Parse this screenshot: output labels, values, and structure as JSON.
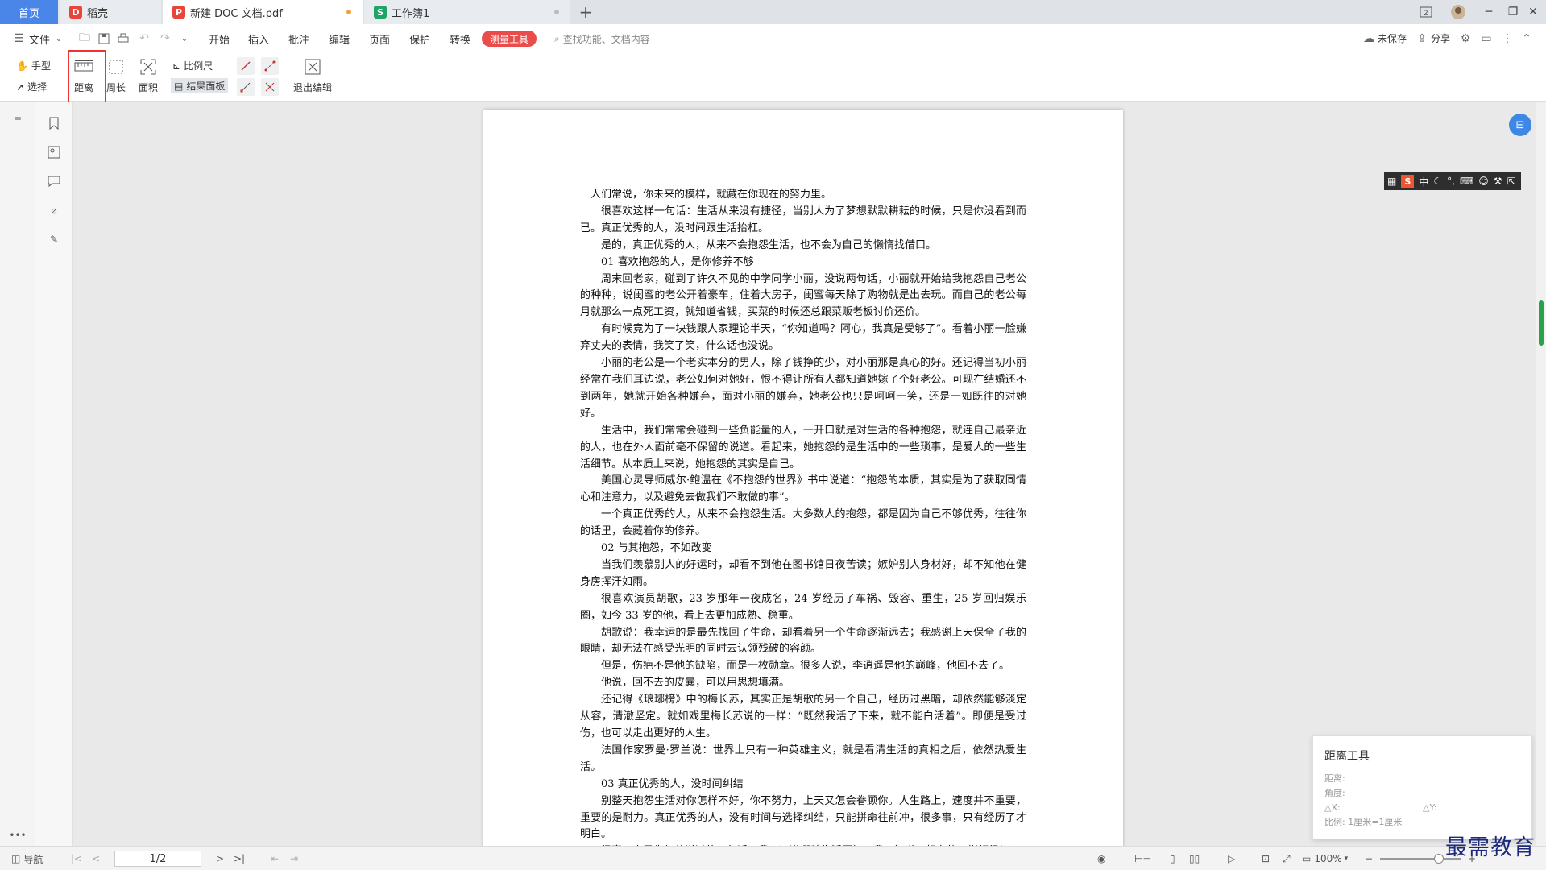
{
  "tabs": {
    "home": "首页",
    "tab1": "稻壳",
    "tab2": "新建 DOC 文档.pdf",
    "tab3": "工作簿1",
    "add": "+"
  },
  "menu": {
    "file": "文件",
    "items": [
      "开始",
      "插入",
      "批注",
      "编辑",
      "页面",
      "保护",
      "转换"
    ],
    "active": "测量工具",
    "search_placeholder": "查找功能、文档内容",
    "unsaved": "未保存",
    "share": "分享"
  },
  "ribbon": {
    "hand": "手型",
    "select": "选择",
    "distance": "距离",
    "perimeter": "周长",
    "area": "面积",
    "scale": "比例尺",
    "result_panel": "结果面板",
    "exit_edit": "退出编辑"
  },
  "document": {
    "paragraphs": [
      "人们常说，你未来的模样，就藏在你现在的努力里。",
      "很喜欢这样一句话：生活从来没有捷径，当别人为了梦想默默耕耘的时候，只是你没看到而已。真正优秀的人，没时间跟生活抬杠。",
      "是的，真正优秀的人，从来不会抱怨生活，也不会为自己的懒惰找借口。",
      "01 喜欢抱怨的人，是你修养不够",
      "周末回老家，碰到了许久不见的中学同学小丽，没说两句话，小丽就开始给我抱怨自己老公的种种，说闺蜜的老公开着豪车，住着大房子，闺蜜每天除了购物就是出去玩。而自己的老公每月就那么一点死工资，就知道省钱，买菜的时候还总跟菜贩老板讨价还价。",
      "有时候竟为了一块钱跟人家理论半天，“你知道吗？阿心，我真是受够了”。看着小丽一脸嫌弃丈夫的表情，我笑了笑，什么话也没说。",
      "小丽的老公是一个老实本分的男人，除了钱挣的少，对小丽那是真心的好。还记得当初小丽经常在我们耳边说，老公如何对她好，恨不得让所有人都知道她嫁了个好老公。可现在结婚还不到两年，她就开始各种嫌弃，面对小丽的嫌弃，她老公也只是呵呵一笑，还是一如既往的对她好。",
      "生活中，我们常常会碰到一些负能量的人，一开口就是对生活的各种抱怨，就连自己最亲近的人，也在外人面前毫不保留的说道。看起来，她抱怨的是生活中的一些琐事，是爱人的一些生活细节。从本质上来说，她抱怨的其实是自己。",
      "美国心灵导师威尔·鲍温在《不抱怨的世界》书中说道：“抱怨的本质，其实是为了获取同情心和注意力，以及避免去做我们不敢做的事”。",
      "一个真正优秀的人，从来不会抱怨生活。大多数人的抱怨，都是因为自己不够优秀，往往你的话里，会藏着你的修养。",
      "02 与其抱怨，不如改变",
      "当我们羡慕别人的好运时，却看不到他在图书馆日夜苦读；嫉妒别人身材好，却不知他在健身房挥汗如雨。",
      "很喜欢演员胡歌，23 岁那年一夜成名，24 岁经历了车祸、毁容、重生，25 岁回归娱乐圈，如今 33 岁的他，看上去更加成熟、稳重。",
      "胡歌说：我幸运的是最先找回了生命，却看着另一个生命逐渐远去；我感谢上天保全了我的眼睛，却无法在感受光明的同时去认领残破的容颜。",
      "但是，伤疤不是他的缺陷，而是一枚勋章。很多人说，李逍遥是他的巅峰，他回不去了。",
      "他说，回不去的皮囊，可以用思想填满。",
      "还记得《琅琊榜》中的梅长苏，其实正是胡歌的另一个自己，经历过黑暗，却依然能够淡定从容，清澈坚定。就如戏里梅长苏说的一样：“既然我活了下来，就不能白活着”。即便是受过伤，也可以走出更好的人生。",
      "法国作家罗曼·罗兰说：世界上只有一种英雄主义，就是看清生活的真相之后，依然热爱生活。",
      "03 真正优秀的人，没时间纠结",
      "别整天抱怨生活对你怎样不好，你不努力，上天又怎会眷顾你。人生路上，速度并不重要，重要的是耐力。真正优秀的人，没有时间与选择纠结，只能拼命往前冲，很多事，只有经历了才明白。",
      "很喜欢小灵先生曾说过的一句话：我不知道哪种生活更好，我只知道，努力的一样都很好。"
    ]
  },
  "ime": {
    "lang": "中"
  },
  "distance_panel": {
    "title": "距离工具",
    "distance_label": "距离:",
    "angle_label": "角度:",
    "dx_label": "△X:",
    "dy_label": "△Y:",
    "scale_label": "比例: 1厘米=1厘米"
  },
  "status": {
    "nav": "导航",
    "page": "1/2",
    "zoom": "100%"
  },
  "watermark": "最需教育",
  "colors": {
    "accent": "#4a86e8",
    "measure": "#ea4b4b",
    "highlight": "#e33333"
  }
}
